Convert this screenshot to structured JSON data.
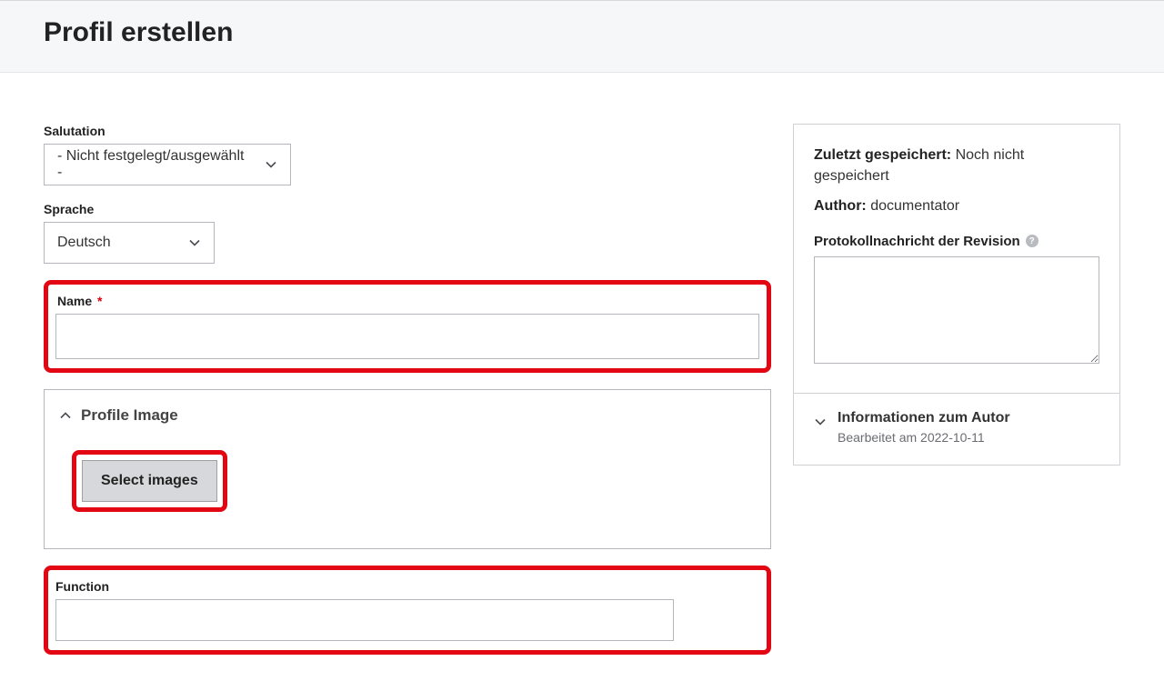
{
  "header": {
    "page_title": "Profil erstellen"
  },
  "form": {
    "salutation": {
      "label": "Salutation",
      "selected": "- Nicht festgelegt/ausgewählt -"
    },
    "language": {
      "label": "Sprache",
      "selected": "Deutsch"
    },
    "name": {
      "label": "Name",
      "required_mark": "*",
      "value": ""
    },
    "profile_image": {
      "panel_title": "Profile Image",
      "button_label": "Select images"
    },
    "function": {
      "label": "Function",
      "value": ""
    }
  },
  "sidebar": {
    "last_saved_label": "Zuletzt gespeichert:",
    "last_saved_value": "Noch nicht gespeichert",
    "author_label": "Author:",
    "author_value": "documentator",
    "revision_label": "Protokollnachricht der Revision",
    "revision_value": "",
    "help_glyph": "?",
    "author_info": {
      "title": "Informationen zum Autor",
      "subtitle": "Bearbeitet am 2022-10-11"
    }
  }
}
